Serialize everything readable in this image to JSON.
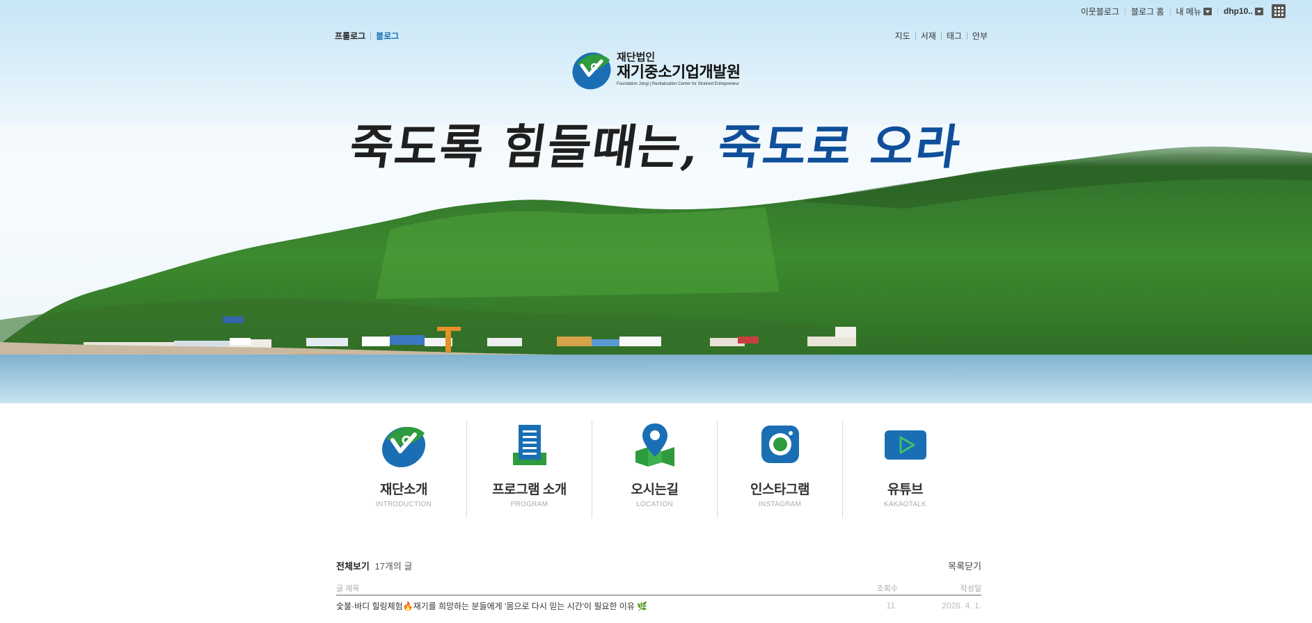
{
  "topbar": {
    "neighbor_blog": "이웃블로그",
    "blog_home": "블로그 홈",
    "my_menu": "내 메뉴",
    "user": "dhp10..",
    "apps_icon": "grid-icon"
  },
  "bloglinks": {
    "prologue": "프롤로그",
    "blog": "블로그"
  },
  "menulinks": [
    "지도",
    "서재",
    "태그",
    "안부"
  ],
  "logo": {
    "line1": "재단법인",
    "line2": "재기중소기업개발원",
    "line3": "Foundation Jongi | Revitalization Center for Strained Entrepreneur"
  },
  "headline": {
    "dark": "죽도록 힘들때는,",
    "blue": "죽도로 오라"
  },
  "icon_menu": [
    {
      "title": "재단소개",
      "subtitle": "INTRODUCTION",
      "icon": "foundation-logo-icon"
    },
    {
      "title": "프로그램 소개",
      "subtitle": "PROGRAM",
      "icon": "document-icon"
    },
    {
      "title": "오시는길",
      "subtitle": "LOCATION",
      "icon": "map-pin-icon"
    },
    {
      "title": "인스타그램",
      "subtitle": "INSTAGRAM",
      "icon": "instagram-icon"
    },
    {
      "title": "유튜브",
      "subtitle": "KAKAOTALK",
      "icon": "play-icon"
    }
  ],
  "post_list": {
    "all_label": "전체보기",
    "count": "17개의 글",
    "close_label": "목록닫기",
    "columns": {
      "title": "글 제목",
      "views": "조회수",
      "date": "작성일"
    },
    "rows": [
      {
        "title": "숯불·바디 힐링체험🔥재기를 희망하는 분들에게 '몸으로 다시 믿는 시간'이 필요한 이유 🌿",
        "views": "11",
        "date": "2026. 4. 1."
      }
    ]
  },
  "colors": {
    "accent_blue": "#0f4f9a",
    "link_blue": "#1a6fb4",
    "brand_green": "#2e9b3e"
  }
}
